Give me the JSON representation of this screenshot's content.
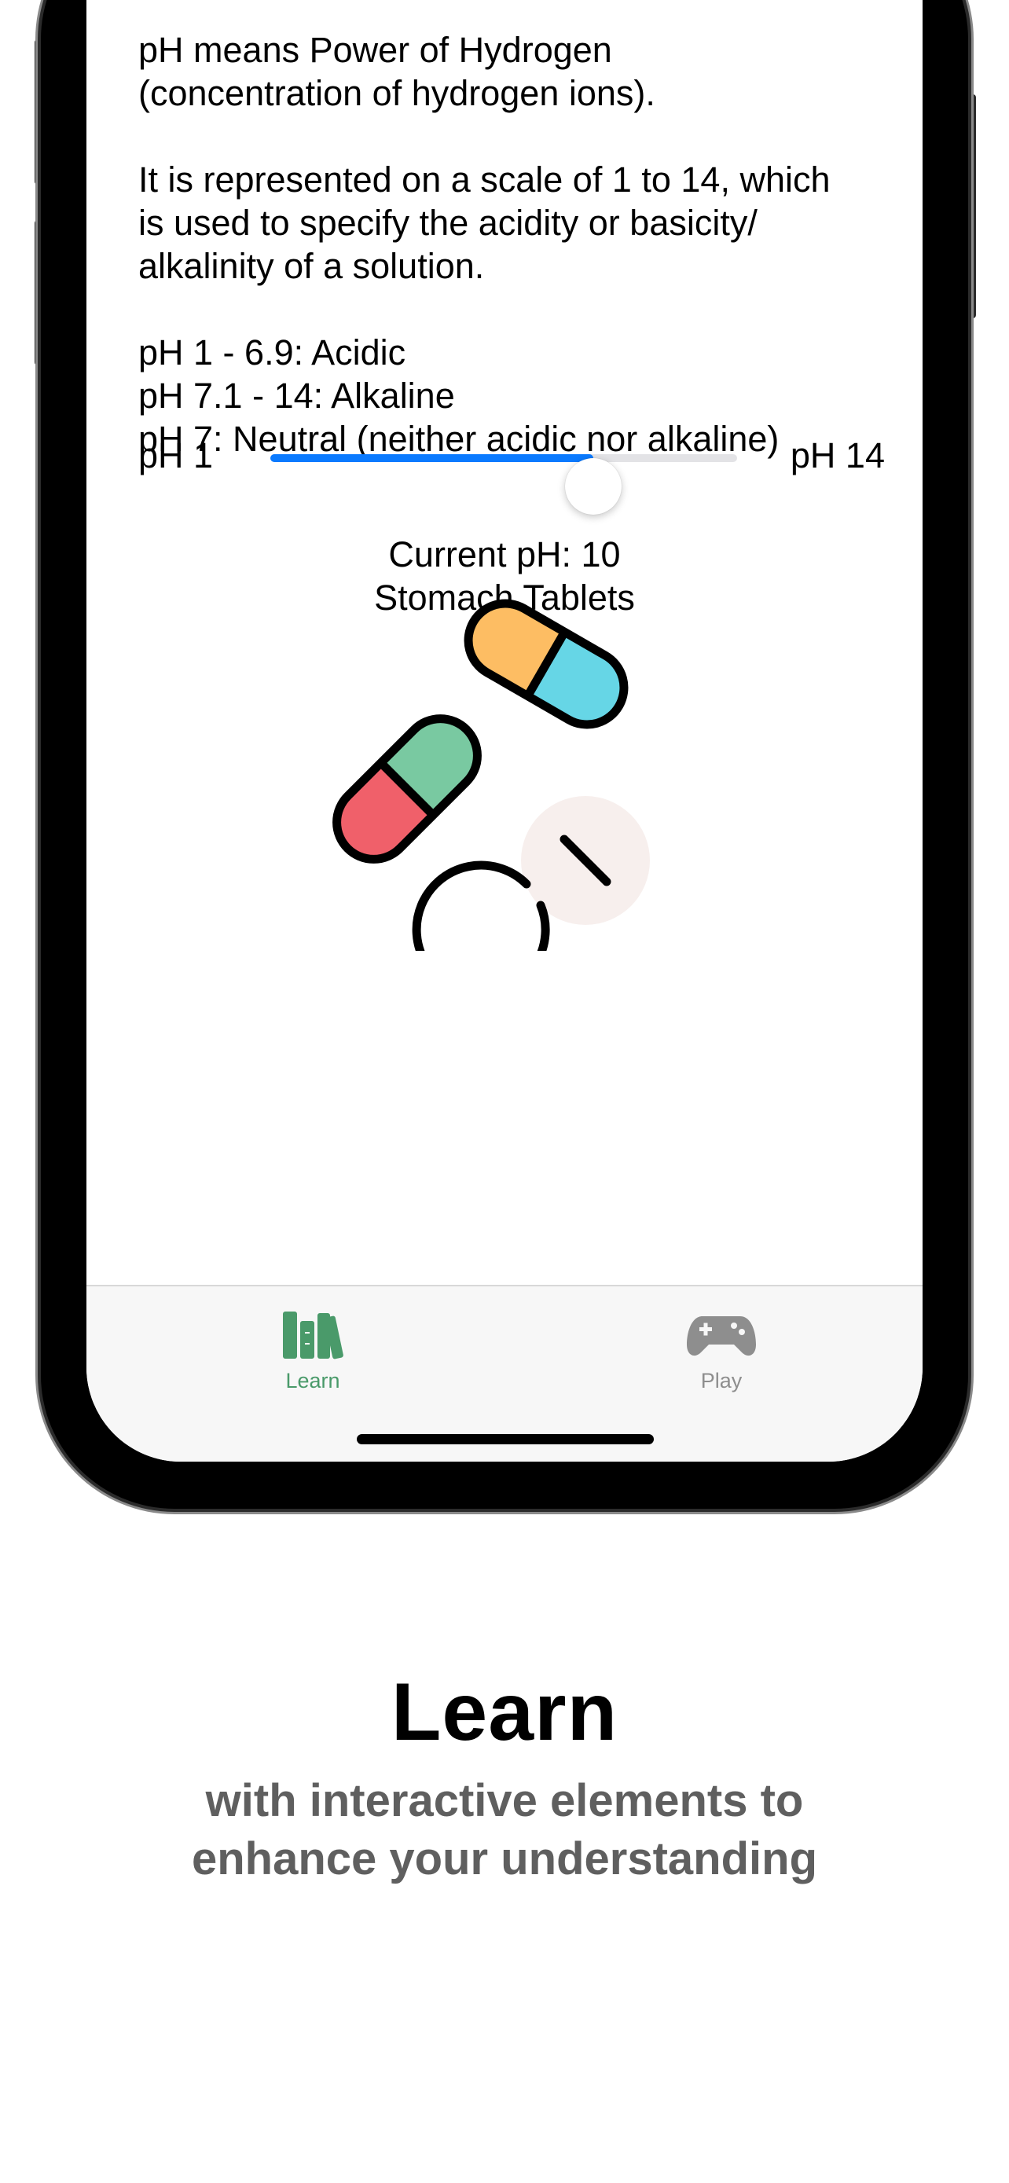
{
  "content": {
    "paragraph1": "pH means Power of Hydrogen\n(concentration of hydrogen ions).",
    "paragraph2": "It is represented on a scale of 1 to 14, which\nis used to specify the acidity or basicity/\nalkalinity of a solution.",
    "paragraph3": "pH 1 - 6.9: Acidic\npH 7.1 - 14:  Alkaline\npH 7: Neutral (neither acidic nor alkaline)"
  },
  "slider": {
    "min_label": "pH 1",
    "max_label": "pH 14",
    "min": 1,
    "max": 14,
    "value": 10,
    "accent_color": "#0a7aff"
  },
  "status": {
    "current_line": "Current pH: 10",
    "example": "Stomach Tablets"
  },
  "illustration": {
    "icon": "pills-icon"
  },
  "tabbar": {
    "tabs": [
      {
        "label": "Learn",
        "icon": "books-icon",
        "selected": true,
        "color": "#4a9a6a"
      },
      {
        "label": "Play",
        "icon": "gamecontroller-icon",
        "selected": false,
        "color": "#8e8e8e"
      }
    ]
  },
  "promo": {
    "title": "Learn",
    "subtitle": "with interactive elements to\nenhance your understanding"
  }
}
